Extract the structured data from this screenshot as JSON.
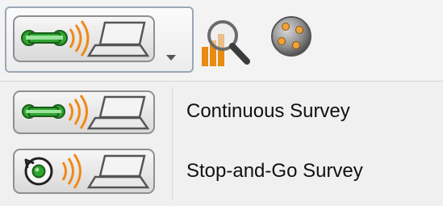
{
  "toolbar": {
    "survey_mode_dropdown": {
      "selected": "Continuous Survey"
    },
    "icons": [
      "continuous-survey-icon",
      "chevron-down-icon",
      "chart-search-icon",
      "satellite-globe-icon"
    ]
  },
  "menu": {
    "items": [
      {
        "label": "Continuous Survey",
        "icon": "continuous-survey-icon"
      },
      {
        "label": "Stop-and-Go Survey",
        "icon": "stop-and-go-survey-icon"
      }
    ]
  },
  "colors": {
    "link_green": "#2fa52f",
    "signal_orange": "#f08a18",
    "chart_orange": "#e98a11",
    "dropdown_border": "#9aa7b5"
  }
}
